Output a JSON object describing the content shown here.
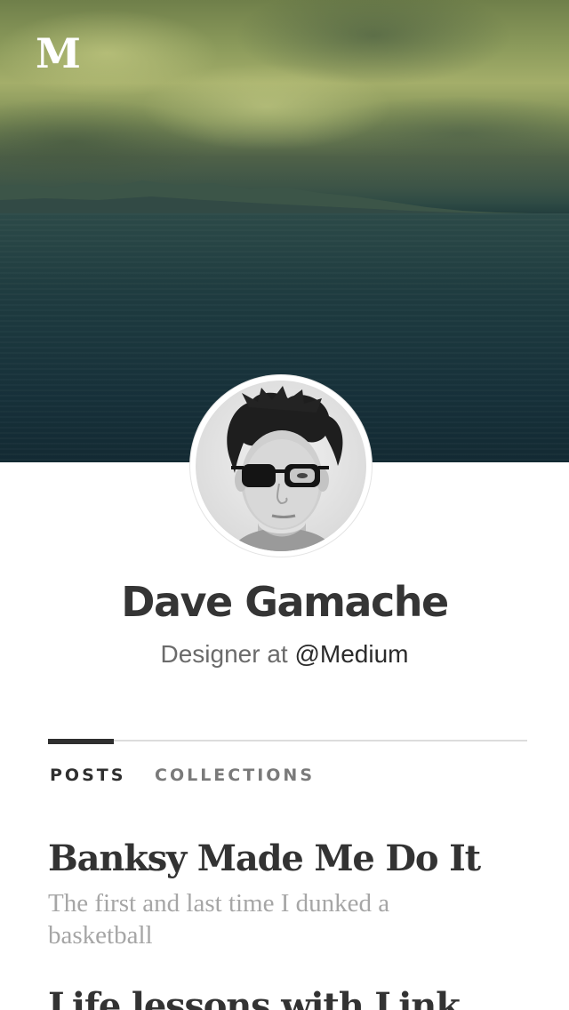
{
  "app": {
    "logo_letter": "M"
  },
  "profile": {
    "name": "Dave Gamache",
    "bio_prefix": "Designer at",
    "bio_handle": "@Medium"
  },
  "tabs": [
    {
      "label": "POSTS",
      "active": true
    },
    {
      "label": "COLLECTIONS",
      "active": false
    }
  ],
  "posts": [
    {
      "title": "Banksy Made Me Do It",
      "subtitle": "The first and last time I dunked a basketball"
    },
    {
      "title": "Life lessons with Link",
      "subtitle": ""
    }
  ],
  "colors": {
    "name_text": "#353535",
    "subtitle_text": "#a6a6a6",
    "tab_active": "#2f2f2f",
    "tab_inactive": "#7a7a7a",
    "divider": "#dcdcdc"
  },
  "icons": {
    "logo": "medium-logo-icon",
    "avatar": "profile-photo"
  }
}
